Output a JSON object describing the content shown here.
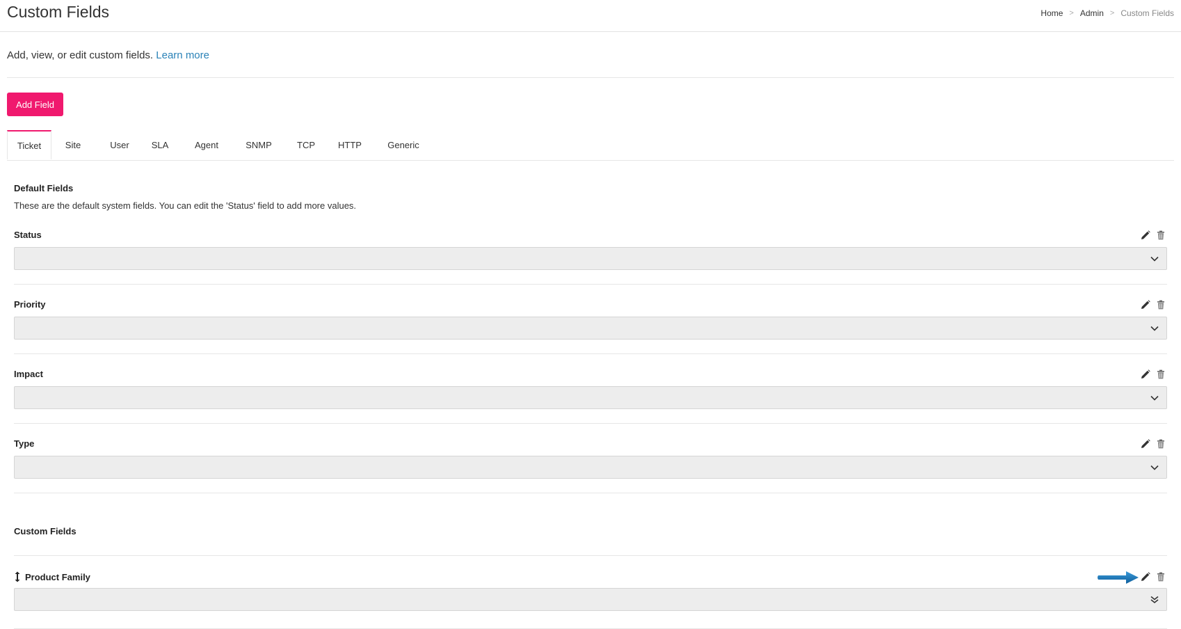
{
  "header": {
    "title": "Custom Fields",
    "breadcrumb": [
      "Home",
      "Admin",
      "Custom Fields"
    ],
    "separator": ">"
  },
  "intro": {
    "text": "Add, view, or edit custom fields.",
    "link": "Learn more"
  },
  "add_button_label": "Add Field",
  "tabs": [
    "Ticket",
    "Site",
    "User",
    "SLA",
    "Agent",
    "SNMP",
    "TCP",
    "HTTP",
    "Generic"
  ],
  "active_tab": "Ticket",
  "default_section": {
    "title": "Default Fields",
    "description": "These are the default system fields. You can edit the 'Status' field to add more values.",
    "fields": [
      {
        "label": "Status"
      },
      {
        "label": "Priority"
      },
      {
        "label": "Impact"
      },
      {
        "label": "Type"
      }
    ]
  },
  "custom_section": {
    "title": "Custom Fields",
    "fields": [
      {
        "label": "Product Family"
      }
    ]
  },
  "colors": {
    "accent": "#f0196e",
    "link": "#2a82b7",
    "select_bg": "#ededed",
    "arrow": "#1a78b8"
  },
  "icons": {
    "edit": "pencil-icon",
    "delete": "trash-icon",
    "dropdown": "chevron-down-icon",
    "multi_dropdown": "double-chevron-down-icon",
    "drag": "drag-handle-icon",
    "pointer": "arrow-pointer-icon"
  }
}
